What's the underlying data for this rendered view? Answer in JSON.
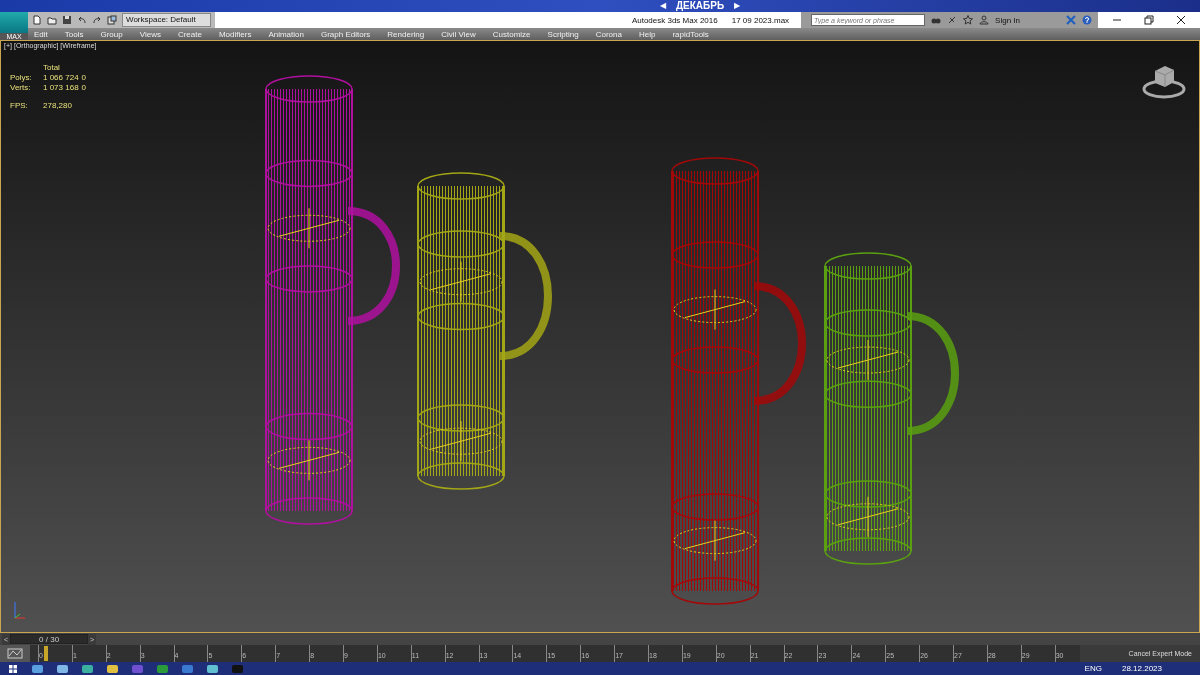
{
  "desktop": {
    "month": "ДЕКАБРЬ",
    "prev": "◀",
    "next": "▶"
  },
  "title_bar": {
    "app_button": "MAX",
    "workspace": "Workspace: Default",
    "title": "Autodesk 3ds Max 2016",
    "file": "17 09 2023.max",
    "search": {
      "placeholder": "Type a keyword or phrase"
    },
    "sign_in": "Sign In"
  },
  "menu": [
    "Edit",
    "Tools",
    "Group",
    "Views",
    "Create",
    "Modifiers",
    "Animation",
    "Graph Editors",
    "Rendering",
    "Civil View",
    "Customize",
    "Scripting",
    "Corona",
    "Help",
    "rapidTools"
  ],
  "viewport": {
    "labels": [
      "[+]",
      "[Orthographic]",
      "[Wireframe]"
    ],
    "stats": {
      "header": "Total",
      "rows": [
        {
          "label": "Polys:",
          "total": "1 066 724",
          "selected": "0"
        },
        {
          "label": "Verts:",
          "total": "1 073 168",
          "selected": "0"
        }
      ],
      "fps_label": "FPS:",
      "fps": "278,280"
    }
  },
  "time_slider": {
    "prev": "<",
    "position": "0 / 30",
    "next": ">",
    "level": 0
  },
  "track_bar": {
    "ticks": [
      "0",
      "1",
      "2",
      "3",
      "4",
      "5",
      "6",
      "7",
      "8",
      "9",
      "10",
      "11",
      "12",
      "13",
      "14",
      "15",
      "16",
      "17",
      "18",
      "19",
      "20",
      "21",
      "22",
      "23",
      "24",
      "25",
      "26",
      "27",
      "28",
      "29",
      "30"
    ],
    "level": 0,
    "button": "Cancel Expert Mode"
  },
  "taskbar": {
    "language": "ENG",
    "date": "28.12.2023"
  }
}
